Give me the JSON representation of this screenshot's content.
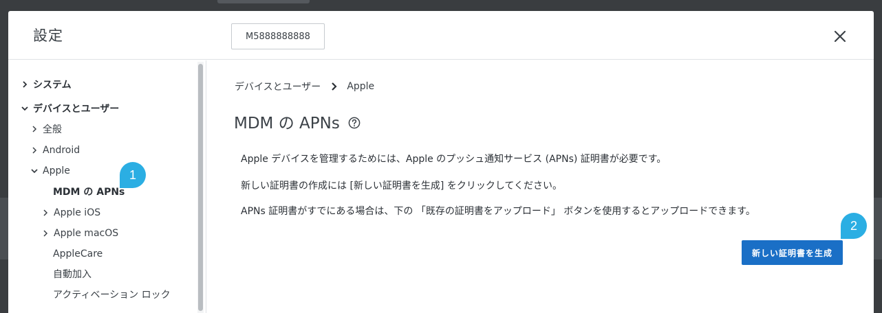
{
  "dialog": {
    "title": "設定",
    "device_name": "M5888888888"
  },
  "sidebar": {
    "items": [
      {
        "label": "システム",
        "chevron": "right",
        "bold": true
      },
      {
        "label": "デバイスとユーザー",
        "chevron": "down",
        "bold": true
      },
      {
        "label": "全般",
        "chevron": "right"
      },
      {
        "label": "Android",
        "chevron": "right"
      },
      {
        "label": "Apple",
        "chevron": "down"
      },
      {
        "label": "MDM の APNs",
        "selected": true
      },
      {
        "label": "Apple iOS",
        "chevron": "right"
      },
      {
        "label": "Apple macOS",
        "chevron": "right"
      },
      {
        "label": "AppleCare"
      },
      {
        "label": "自動加入"
      },
      {
        "label": "アクティベーション ロック"
      }
    ]
  },
  "breadcrumb": {
    "parent": "デバイスとユーザー",
    "current": "Apple"
  },
  "main": {
    "title": "MDM の APNs",
    "paragraphs": [
      "Apple デバイスを管理するためには、Apple のプッシュ通知サービス (APNs) 証明書が必要です。",
      "新しい証明書の作成には [新しい証明書を生成] をクリックしてください。",
      "APNs 証明書がすでにある場合は、下の 「既存の証明書をアップロード」 ボタンを使用するとアップロードできます。"
    ],
    "generate_button": "新しい証明書を生成"
  },
  "annotations": {
    "badge1": "1",
    "badge2": "2"
  },
  "colors": {
    "primary": "#1a6fc6",
    "badge": "#2baee3"
  }
}
